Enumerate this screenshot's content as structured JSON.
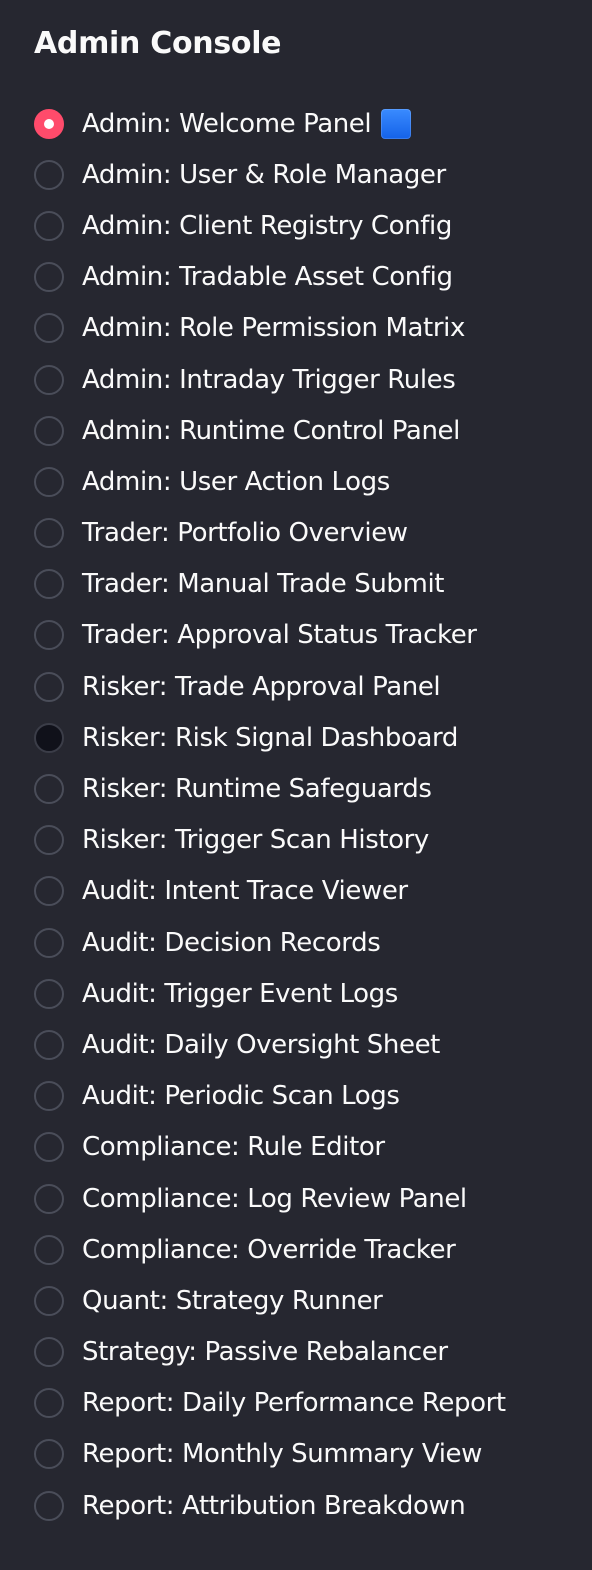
{
  "sidebar": {
    "title": "Admin Console",
    "options": [
      {
        "label": "Admin: Welcome Panel",
        "state": "selected",
        "icon": "blue-square-icon"
      },
      {
        "label": "Admin: User & Role Manager",
        "state": "default"
      },
      {
        "label": "Admin: Client Registry Config",
        "state": "default"
      },
      {
        "label": "Admin: Tradable Asset Config",
        "state": "default"
      },
      {
        "label": "Admin: Role Permission Matrix",
        "state": "default"
      },
      {
        "label": "Admin: Intraday Trigger Rules",
        "state": "default"
      },
      {
        "label": "Admin: Runtime Control Panel",
        "state": "default"
      },
      {
        "label": "Admin: User Action Logs",
        "state": "default"
      },
      {
        "label": "Trader: Portfolio Overview",
        "state": "default"
      },
      {
        "label": "Trader: Manual Trade Submit",
        "state": "default"
      },
      {
        "label": "Trader: Approval Status Tracker",
        "state": "default"
      },
      {
        "label": "Risker: Trade Approval Panel",
        "state": "default"
      },
      {
        "label": "Risker: Risk Signal Dashboard",
        "state": "focused"
      },
      {
        "label": "Risker: Runtime Safeguards",
        "state": "default"
      },
      {
        "label": "Risker: Trigger Scan History",
        "state": "default"
      },
      {
        "label": "Audit: Intent Trace Viewer",
        "state": "default"
      },
      {
        "label": "Audit: Decision Records",
        "state": "default"
      },
      {
        "label": "Audit: Trigger Event Logs",
        "state": "default"
      },
      {
        "label": "Audit: Daily Oversight Sheet",
        "state": "default"
      },
      {
        "label": "Audit: Periodic Scan Logs",
        "state": "default"
      },
      {
        "label": "Compliance: Rule Editor",
        "state": "default"
      },
      {
        "label": "Compliance: Log Review Panel",
        "state": "default"
      },
      {
        "label": "Compliance: Override Tracker",
        "state": "default"
      },
      {
        "label": "Quant: Strategy Runner",
        "state": "default"
      },
      {
        "label": "Strategy: Passive Rebalancer",
        "state": "default"
      },
      {
        "label": "Report: Daily Performance Report",
        "state": "default"
      },
      {
        "label": "Report: Monthly Summary View",
        "state": "default"
      },
      {
        "label": "Report: Attribution Breakdown",
        "state": "default"
      }
    ]
  },
  "colors": {
    "background": "#262730",
    "text": "#fafafa",
    "accent": "#ff4b6b",
    "radio_border": "#4a4d59",
    "focused_fill": "#10111a"
  }
}
